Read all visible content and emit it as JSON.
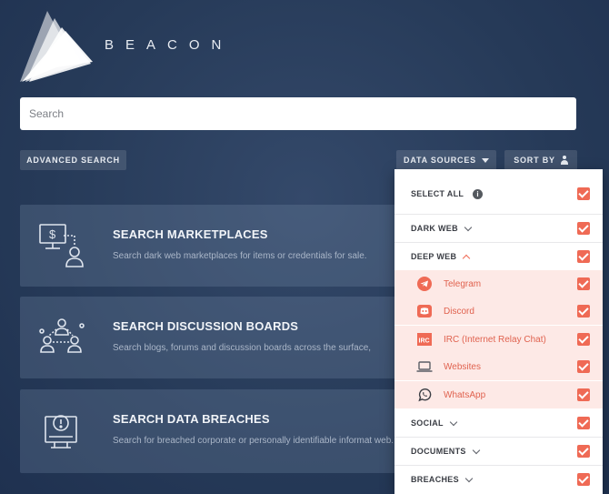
{
  "brand": {
    "name": "BEACON"
  },
  "search": {
    "placeholder": "Search"
  },
  "toolbar": {
    "advanced_search": "ADVANCED SEARCH",
    "data_sources": "DATA SOURCES",
    "sort_by": "SORT BY"
  },
  "cards": [
    {
      "title": "SEARCH MARKETPLACES",
      "description": "Search dark web marketplaces for items or credentials for sale.",
      "icon": "monitor-dollar-user-icon"
    },
    {
      "title": "SEARCH DISCUSSION BOARDS",
      "description": "Search blogs, forums and discussion boards across the surface,",
      "icon": "users-network-icon"
    },
    {
      "title": "SEARCH DATA BREACHES",
      "description": "Search for breached corporate or personally identifiable informat web.",
      "icon": "breach-alert-monitor-icon"
    }
  ],
  "dropdown": {
    "select_all": "SELECT ALL",
    "groups": {
      "dark_web": "DARK WEB",
      "deep_web": "DEEP WEB",
      "social": "SOCIAL",
      "documents": "DOCUMENTS",
      "breaches": "BREACHES"
    },
    "deep_web_sources": [
      {
        "label": "Telegram",
        "icon": "telegram-icon"
      },
      {
        "label": "Discord",
        "icon": "discord-icon"
      },
      {
        "label": "IRC (Internet Relay Chat)",
        "icon": "irc-icon"
      },
      {
        "label": "Websites",
        "icon": "laptop-icon"
      },
      {
        "label": "WhatsApp",
        "icon": "whatsapp-icon"
      }
    ]
  },
  "colors": {
    "accent": "#ef6a55",
    "background": "#2a3d5c",
    "card": "#4f6482"
  }
}
